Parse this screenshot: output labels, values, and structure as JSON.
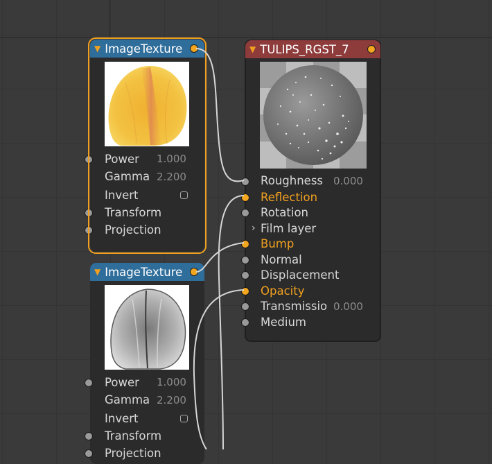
{
  "nodes": {
    "image_texture_1": {
      "title": "ImageTexture",
      "params": [
        {
          "label": "Power",
          "value": "1.000"
        },
        {
          "label": "Gamma",
          "value": "2.200"
        },
        {
          "label": "Invert"
        },
        {
          "label": "Transform"
        },
        {
          "label": "Projection"
        }
      ]
    },
    "image_texture_2": {
      "title": "ImageTexture",
      "params": [
        {
          "label": "Power",
          "value": "1.000"
        },
        {
          "label": "Gamma",
          "value": "2.200"
        },
        {
          "label": "Invert"
        },
        {
          "label": "Transform"
        },
        {
          "label": "Projection"
        }
      ]
    },
    "material": {
      "title": "TULIPS_RGST_7",
      "params": [
        {
          "label": "Roughness",
          "value": "0.000"
        },
        {
          "label": "Reflection"
        },
        {
          "label": "Rotation"
        },
        {
          "label": "Film layer"
        },
        {
          "label": "Bump"
        },
        {
          "label": "Normal"
        },
        {
          "label": "Displacement"
        },
        {
          "label": "Opacity"
        },
        {
          "label": "Transmissio",
          "value": "0.000"
        },
        {
          "label": "Medium"
        }
      ]
    }
  },
  "icons": {
    "collapse": "triangle-down-icon",
    "expand": "chevron-right-icon",
    "socket": "socket-dot-icon",
    "checkbox": "checkbox-icon"
  },
  "colors": {
    "canvas": "#3a3a3a",
    "node_body": "#2b2b2b",
    "texture_header": "#2f6d9a",
    "material_header": "#8e3b3b",
    "accent": "#f0a020",
    "wire": "#d6d6d6"
  }
}
